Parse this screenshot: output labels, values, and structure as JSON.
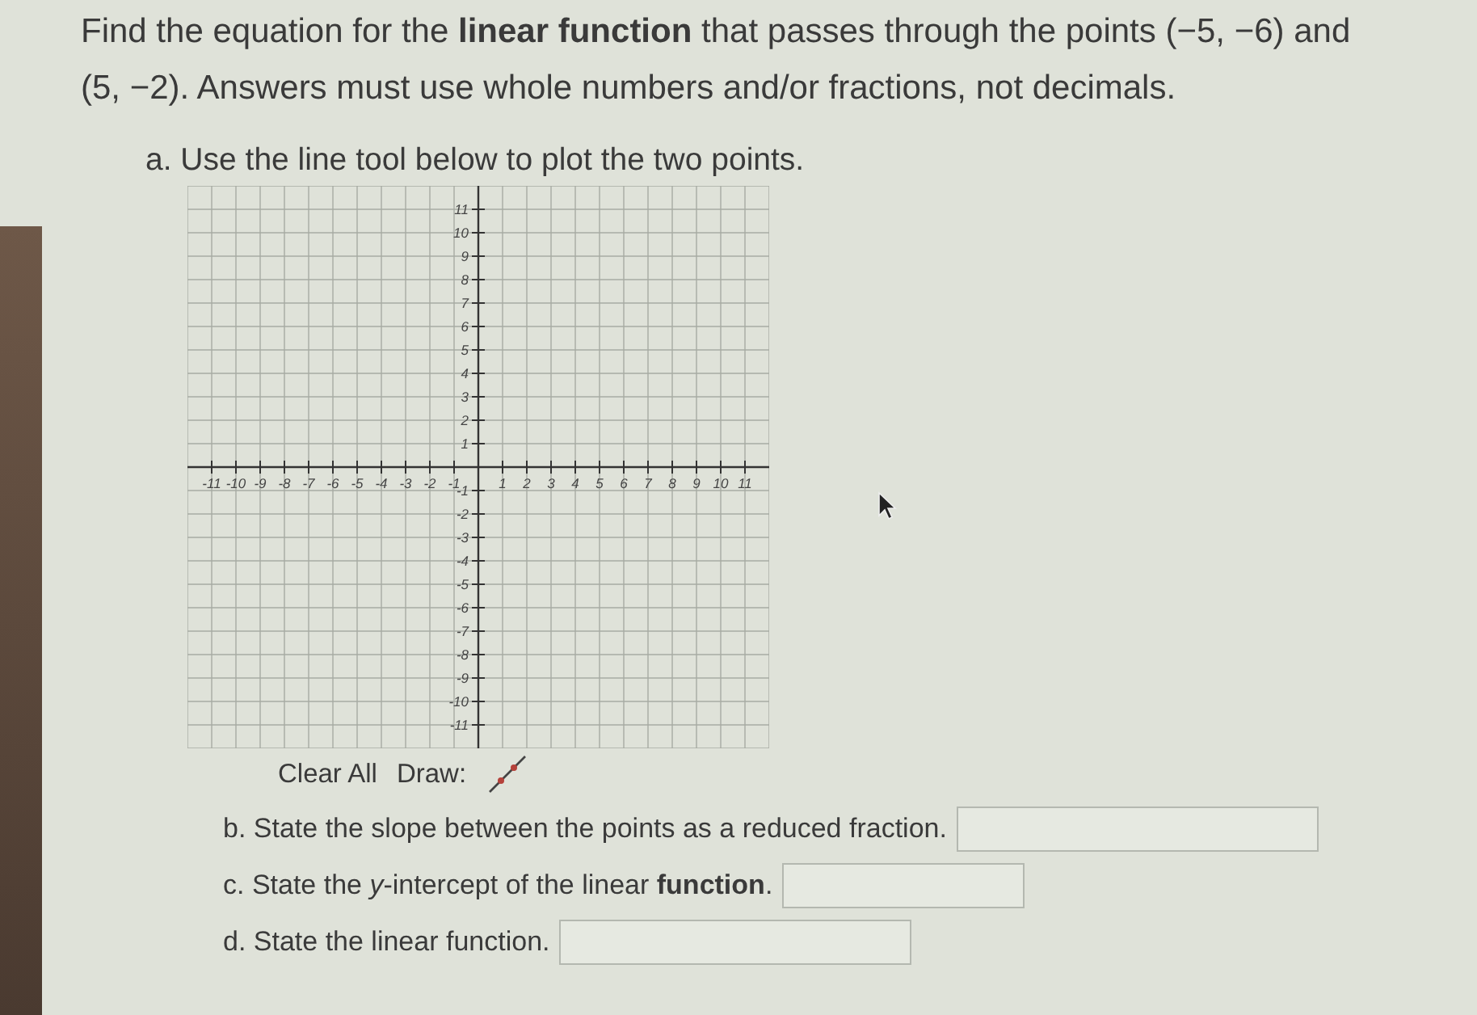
{
  "question": "Find the equation for the **linear function** that passes through the points (−5, −6) and (5, −2). Answers must use whole numbers and/or fractions, not decimals.",
  "part_a": {
    "label": "a. Use the line tool below to plot the two points.",
    "graph": {
      "x_labels": [
        "-11",
        "-10",
        "-9",
        "-8",
        "-7",
        "-6",
        "-5",
        "-4",
        "-3",
        "-2",
        "-1",
        "1",
        "2",
        "3",
        "4",
        "5",
        "6",
        "7",
        "8",
        "9",
        "10",
        "11"
      ],
      "y_labels": [
        "11",
        "10",
        "9",
        "8",
        "7",
        "6",
        "5",
        "4",
        "3",
        "2",
        "1",
        "-1",
        "-2",
        "-3",
        "-4",
        "-5",
        "-6",
        "-7",
        "-8",
        "-9",
        "-10",
        "-11"
      ]
    },
    "toolbar": {
      "clear": "Clear All",
      "draw": "Draw:"
    }
  },
  "answers": [
    {
      "label": "b. State the slope between the points as a reduced fraction."
    },
    {
      "label": "c. State the *y*-intercept of the linear **function**."
    },
    {
      "label": "d. State the linear function."
    }
  ]
}
